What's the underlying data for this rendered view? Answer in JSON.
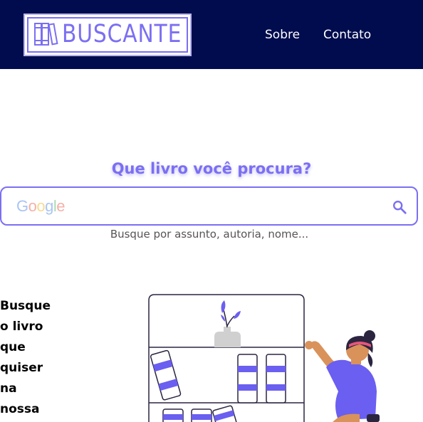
{
  "header": {
    "logo_text": "BUSCANTE",
    "nav": [
      {
        "label": "Sobre"
      },
      {
        "label": "Contato"
      }
    ]
  },
  "search": {
    "heading": "Que livro você procura?",
    "placeholder": "",
    "google_letters": [
      "G",
      "o",
      "o",
      "g",
      "l",
      "e"
    ],
    "hint": "Busque por assunto, autoria, nome..."
  },
  "tagline": {
    "lines": [
      "Busque",
      "o livro",
      "que",
      "quiser",
      "na",
      "nossa"
    ]
  },
  "colors": {
    "header_bg": "#000c4e",
    "accent": "#7b6ff2",
    "skin": "#d9925a",
    "hair": "#2b2540",
    "headband": "#e8567a"
  },
  "icons": {
    "logo": "books-icon",
    "search": "search-icon",
    "illustration": "woman-reaching-bookshelf-illustration"
  }
}
